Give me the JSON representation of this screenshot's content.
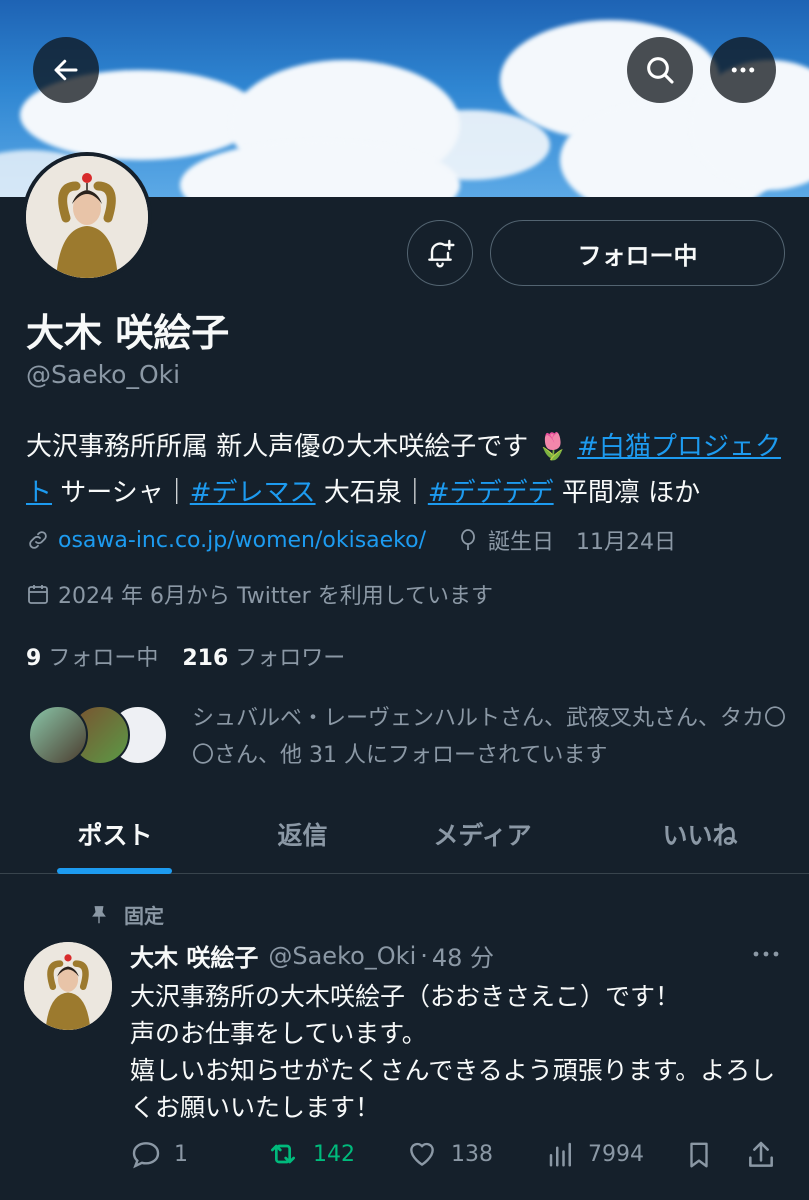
{
  "header": {
    "back_icon": "arrow-left-icon",
    "search_icon": "search-icon",
    "more_icon": "more-horizontal-icon"
  },
  "profile": {
    "display_name": "大木 咲絵子",
    "handle": "@Saeko_Oki",
    "follow_button_label": "フォロー中",
    "notification_icon": "bell-plus-icon",
    "bio": {
      "text1": "大沢事務所所属 新人声優の大木咲絵子です",
      "emoji": "🌷",
      "hashtag1": "#白猫プロジェクト",
      "text2": " サーシャ｜",
      "hashtag2": "#デレマス",
      "text3": " 大石泉｜",
      "hashtag3": "#デデデデ",
      "text4": " 平間凛 ほか"
    },
    "website": "osawa-inc.co.jp/women/okisaeko/",
    "birthday_label": "誕生日",
    "birthday": "11月24日",
    "joined": "2024 年 6月から Twitter を利用しています",
    "following_count": "9",
    "following_label": "フォロー中",
    "followers_count": "216",
    "followers_label": "フォロワー",
    "followed_by": "シュバルベ・レーヴェンハルトさん、武夜叉丸さん、タカ〇〇さん、他 31 人にフォローされています"
  },
  "tabs": [
    {
      "label": "ポスト",
      "active": true
    },
    {
      "label": "返信",
      "active": false
    },
    {
      "label": "メディア",
      "active": false
    },
    {
      "label": "いいね",
      "active": false
    }
  ],
  "pinned_post": {
    "pinned_label": "固定",
    "author_name": "大木 咲絵子",
    "author_handle": "@Saeko_Oki",
    "separator": "·",
    "time": "48 分",
    "body_lines": [
      "大沢事務所の大木咲絵子（おおきさえこ）です！",
      "声のお仕事をしています。",
      "嬉しいお知らせがたくさんできるよう頑張ります。よろしくお願いいたします！"
    ],
    "replies": "1",
    "reposts": "142",
    "likes": "138",
    "views": "7994"
  },
  "colors": {
    "background": "#15202b",
    "accent": "#1d9bf0",
    "muted": "#8b98a5",
    "repost_green": "#00ba7c"
  }
}
